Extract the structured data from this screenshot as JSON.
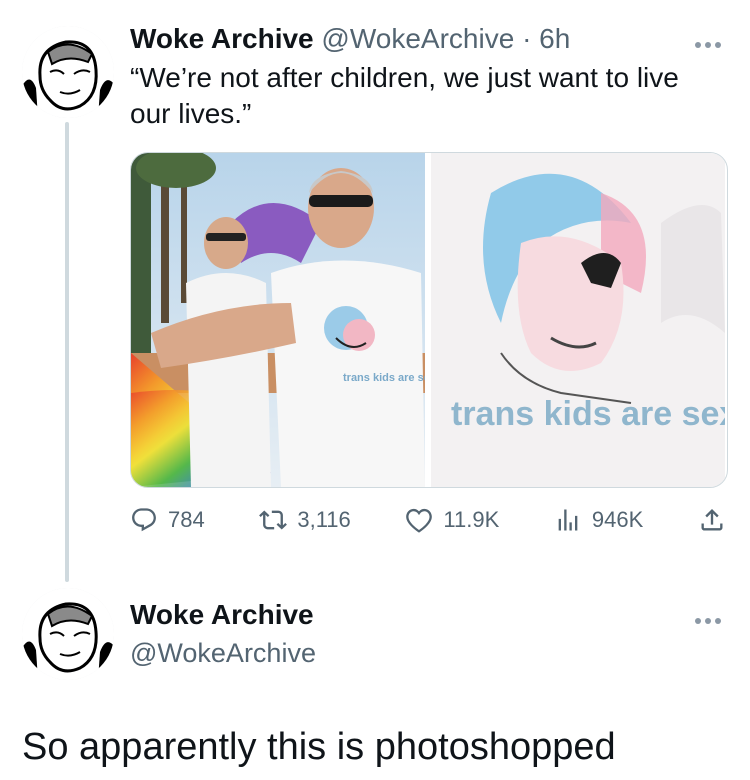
{
  "tweet": {
    "author_name": "Woke Archive",
    "handle": "@WokeArchive",
    "separator": "·",
    "time": "6h",
    "text": "“We’re not after children, we just want to live our lives.”",
    "image_left_shirt_text": "trans kids are sexy",
    "image_right_shirt_text": "trans kids are sexy",
    "stats": {
      "replies": "784",
      "retweets": "3,116",
      "likes": "11.9K",
      "views": "946K"
    }
  },
  "reply": {
    "author_name": "Woke Archive",
    "handle": "@WokeArchive",
    "text": "So apparently this is photoshopped"
  },
  "icons": {
    "more": "more-icon",
    "reply": "reply-icon",
    "retweet": "retweet-icon",
    "like": "heart-icon",
    "views": "views-icon",
    "share": "share-icon"
  },
  "colors": {
    "text": "#0f1419",
    "secondary": "#536471",
    "line": "#cfd9de"
  }
}
